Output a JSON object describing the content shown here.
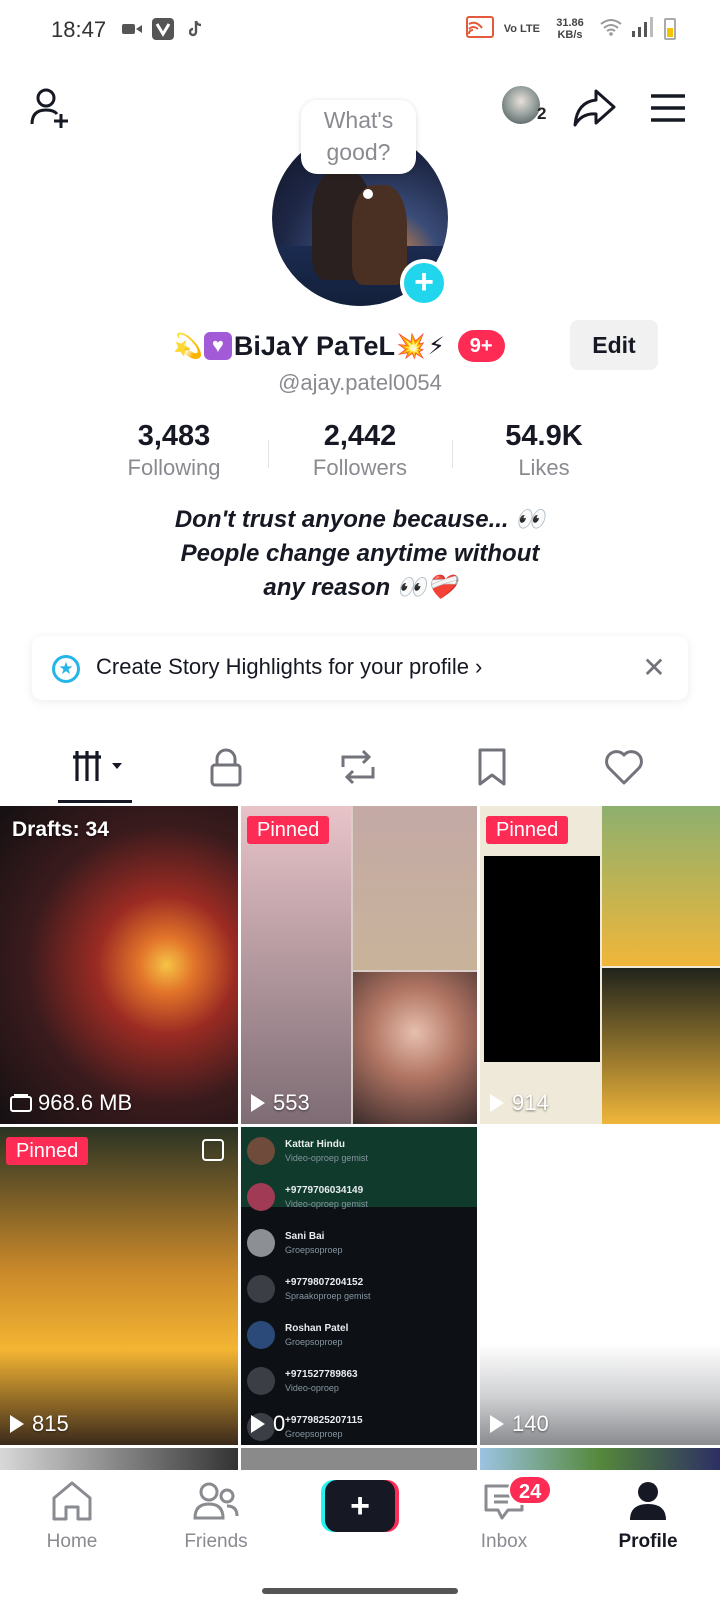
{
  "status_bar": {
    "time": "18:47",
    "network_label": "Vo LTE",
    "speed_value": "31.86",
    "speed_unit": "KB/s"
  },
  "header": {
    "friends_count": "2"
  },
  "profile": {
    "bubble_text": "What's good?",
    "name": "BiJaY PaTeL",
    "notif_badge": "9+",
    "edit_label": "Edit",
    "handle": "@ajay.patel0054",
    "stats": [
      {
        "value": "3,483",
        "label": "Following"
      },
      {
        "value": "2,442",
        "label": "Followers"
      },
      {
        "value": "54.9K",
        "label": "Likes"
      }
    ],
    "bio_lines": [
      "Don't trust anyone because... 👀",
      "People change anytime without",
      "any reason 👀❤️‍🩹"
    ]
  },
  "highlights_banner": {
    "text": "Create Story Highlights for your profile"
  },
  "tabs": [
    "videos",
    "private",
    "reposts",
    "favorites",
    "liked"
  ],
  "grid": {
    "drafts_label": "Drafts: 34",
    "drafts_size": "968.6 MB",
    "pinned_label": "Pinned",
    "views": [
      "553",
      "914",
      "815",
      "0",
      "140"
    ],
    "chat_rows": [
      {
        "name": "Kattar Hindu",
        "sub": "Video-oproep gemist"
      },
      {
        "name": "+9779706034149",
        "sub": "Video-oproep gemist"
      },
      {
        "name": "Sani Bai",
        "sub": "Groepsoproep"
      },
      {
        "name": "+9779807204152",
        "sub": "Spraakoproep gemist"
      },
      {
        "name": "Roshan Patel",
        "sub": "Groepsoproep"
      },
      {
        "name": "+971527789863",
        "sub": "Video-oproep"
      },
      {
        "name": "+9779825207115",
        "sub": "Groepsoproep"
      }
    ]
  },
  "bottom_nav": {
    "home": "Home",
    "friends": "Friends",
    "inbox": "Inbox",
    "inbox_badge": "24",
    "profile": "Profile"
  },
  "colors": {
    "accent_red": "#fe2c55",
    "accent_cyan": "#25f4ee",
    "text_primary": "#161823",
    "text_secondary": "#8a8b91"
  }
}
